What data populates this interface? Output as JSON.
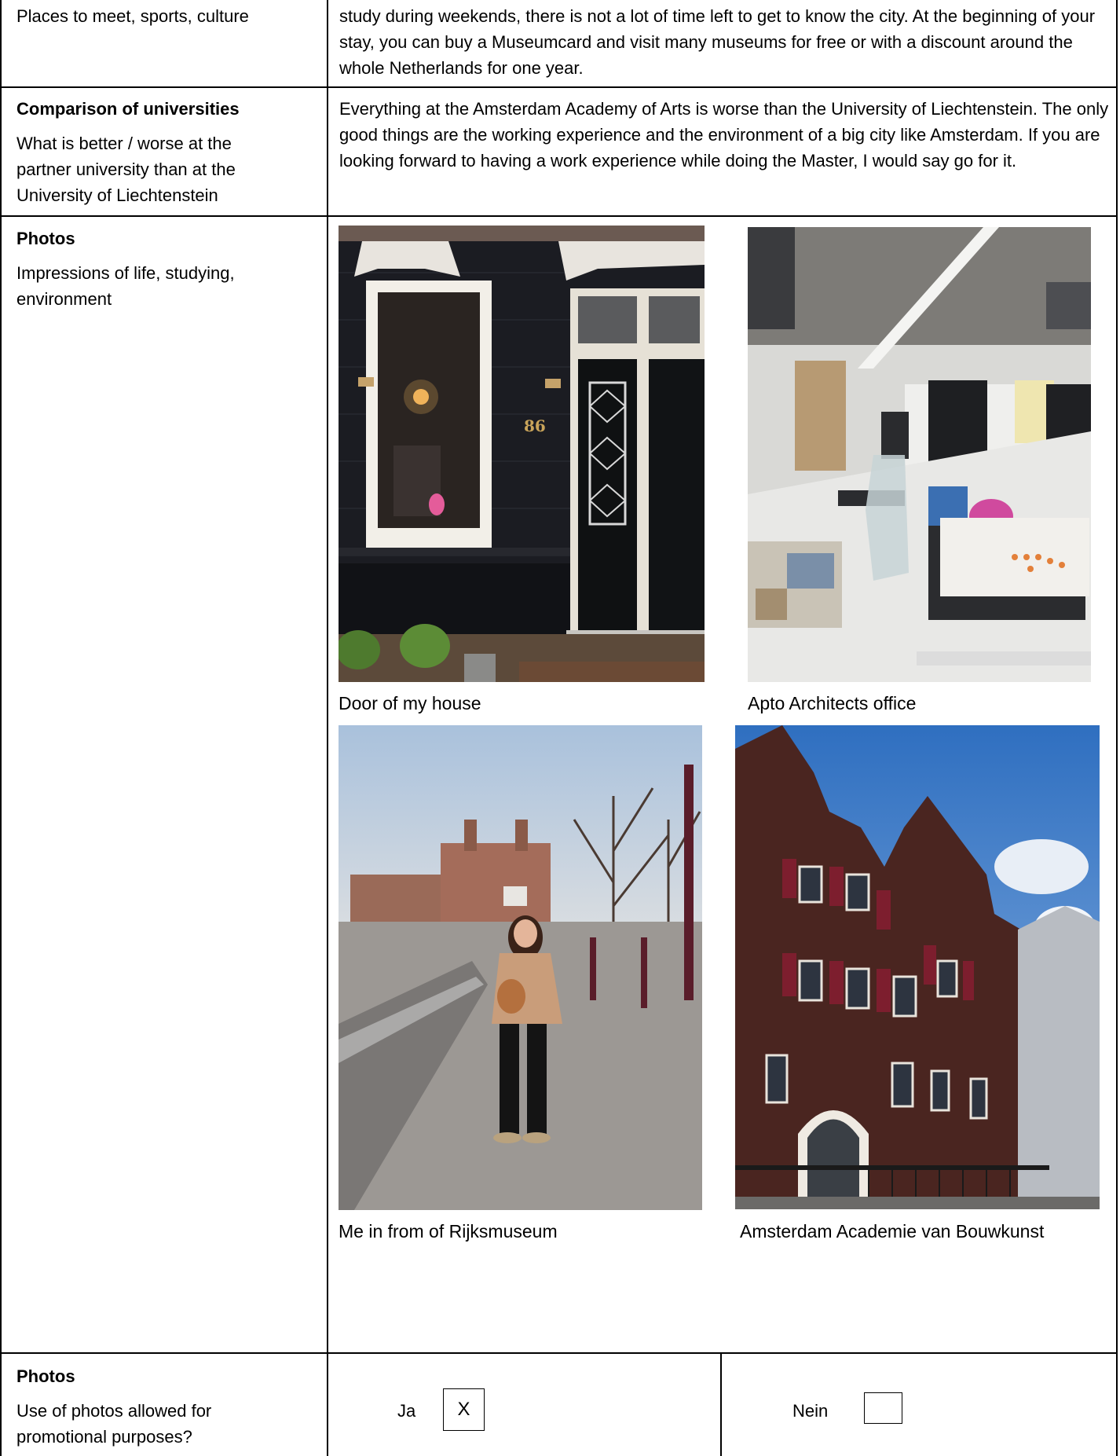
{
  "rows": [
    {
      "label": "Places to meet, sports, culture",
      "text": "study during weekends, there is not a lot of time left to get to know the city. At the beginning of your stay, you can buy a Museumcard and visit many museums for free or with a discount around the whole Netherlands for one year."
    },
    {
      "title": "Comparison of universities",
      "subtitle": "What is better / worse at the partner university than at the University of Liechtenstein",
      "text": "Everything at the Amsterdam Academy of Arts is worse than the University of Liechtenstein. The only good things are the working experience and the environment of a big city like Amsterdam. If you are looking forward to having a work experience while doing the Master, I would say go for it."
    },
    {
      "title": "Photos",
      "subtitle": "Impressions of life, studying, environment",
      "photos": [
        {
          "caption": "Door of my house"
        },
        {
          "caption": "Apto Architects office"
        },
        {
          "caption": "Me in from of Rijksmuseum"
        },
        {
          "caption": "Amsterdam Academie van Bouwkunst"
        }
      ]
    },
    {
      "title": "Photos",
      "subtitle": "Use of photos allowed for promotional purposes?",
      "yes_label": "Ja",
      "yes_value": "X",
      "no_label": "Nein",
      "no_value": ""
    }
  ]
}
